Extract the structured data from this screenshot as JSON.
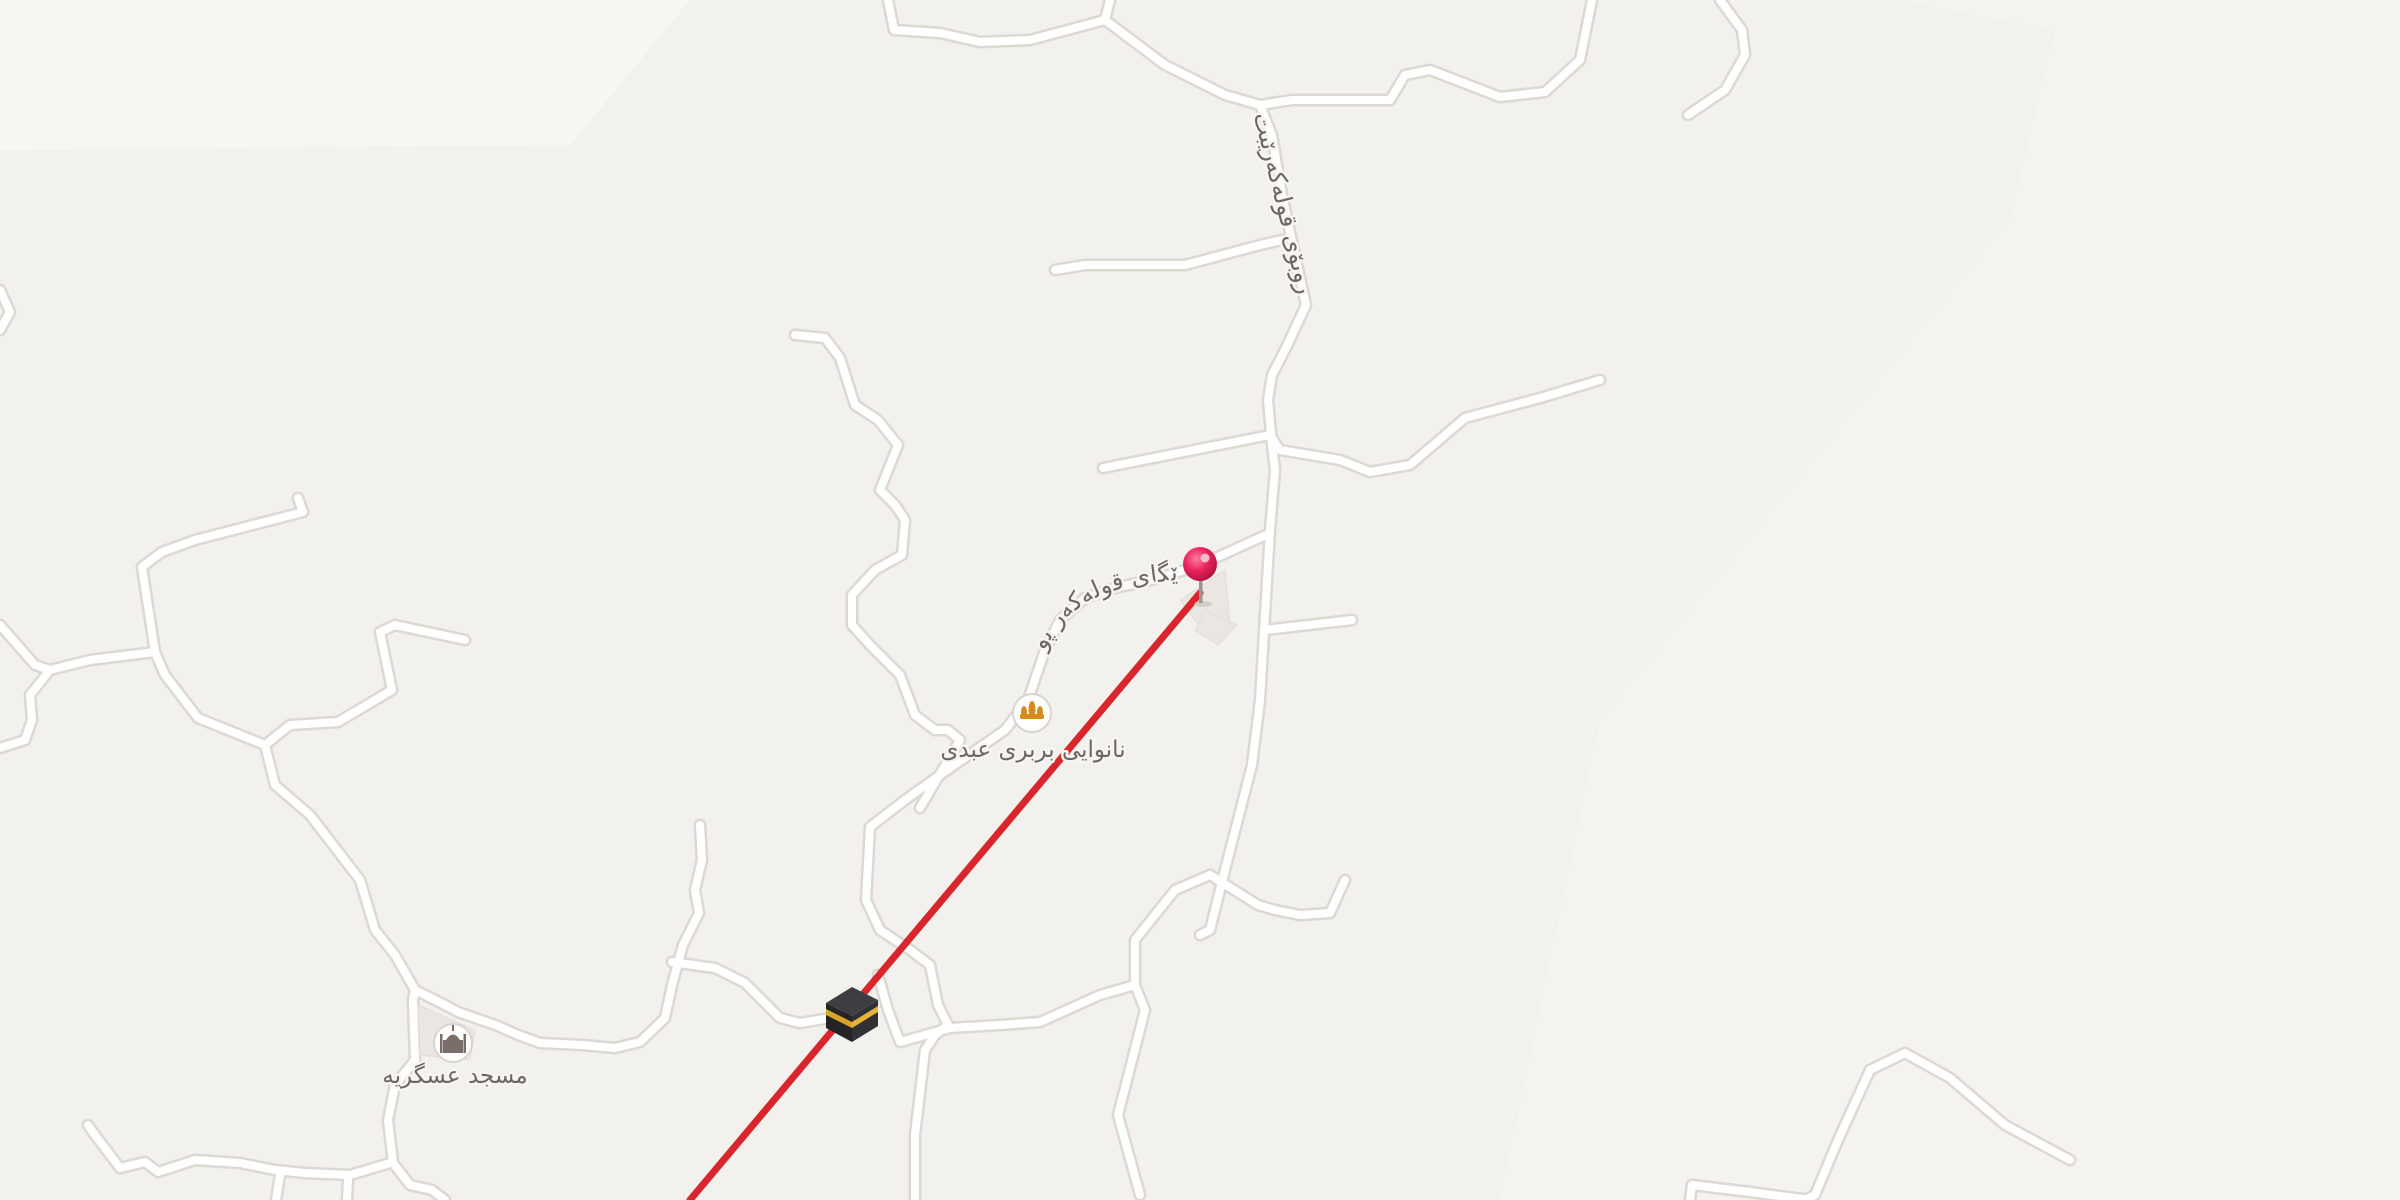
{
  "map": {
    "colors": {
      "background": "#f3f1ee",
      "road_casing": "#dcd8d3",
      "road_fill": "#ffffff",
      "route": "#d9262c",
      "pin": "#e8245b",
      "label_text": "#6a6764"
    },
    "road_labels": {
      "vertical": "روبۆی قولەکەرێبت",
      "curved": "ڕێگای قولەکەر پور"
    },
    "places": [
      {
        "name": "نانوایی بربری عبدی",
        "icon": "bakery-icon",
        "color": "#d98a1c"
      },
      {
        "name": "مسجد عسگریه",
        "icon": "mosque-icon",
        "color": "#7a6f68"
      }
    ],
    "markers": [
      {
        "kind": "destination",
        "icon": "map-pin-icon"
      },
      {
        "kind": "qibla",
        "icon": "kaaba-icon"
      }
    ],
    "route_line": {
      "description": "qibla-direction"
    }
  }
}
